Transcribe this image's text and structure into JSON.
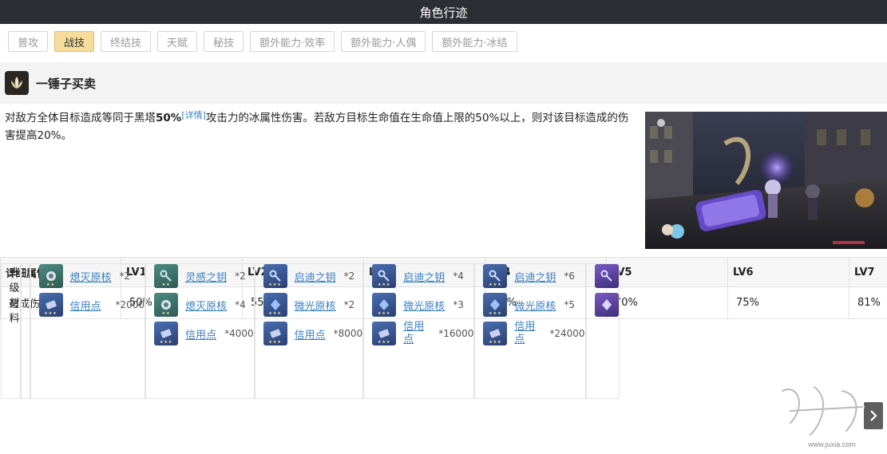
{
  "header": {
    "title": "角色行迹"
  },
  "tabs": [
    {
      "label": "普攻",
      "active": false
    },
    {
      "label": "战技",
      "active": true
    },
    {
      "label": "终结技",
      "active": false
    },
    {
      "label": "天赋",
      "active": false
    },
    {
      "label": "秘技",
      "active": false
    },
    {
      "label": "额外能力·效率",
      "active": false
    },
    {
      "label": "额外能力·人偶",
      "active": false
    },
    {
      "label": "额外能力·冰结",
      "active": false
    }
  ],
  "skill": {
    "icon": "lotus-bud-icon",
    "name": "一锤子买卖",
    "desc_part1": "对敌方全体目标造成等同于黑塔",
    "desc_bold": "50%",
    "desc_detail": "[详情]",
    "desc_part2": "攻击力的冰属性伤害。若敌方目标生命值在生命值上限的50%以上，则对该目标造成的伤害提高20%。"
  },
  "table": {
    "header_label": "详细属性",
    "levels": [
      "LV1",
      "LV2",
      "LV3",
      "LV4",
      "LV5",
      "LV6",
      "LV7"
    ],
    "damage_label": "造成伤害",
    "damage_values": [
      "50%",
      "55%",
      "60%",
      "65%",
      "70%",
      "75%",
      "81%"
    ],
    "materials_label": "升级材料",
    "materials": [
      [],
      [
        {
          "name": "熄灭原核",
          "count": "*2",
          "icon": "green"
        },
        {
          "name": "信用点",
          "count": "*2000",
          "icon": "blue"
        }
      ],
      [
        {
          "name": "灵感之钥",
          "count": "*2",
          "icon": "green"
        },
        {
          "name": "熄灭原核",
          "count": "*4",
          "icon": "green"
        },
        {
          "name": "信用点",
          "count": "*4000",
          "icon": "blue"
        }
      ],
      [
        {
          "name": "启迪之钥",
          "count": "*2",
          "icon": "blue"
        },
        {
          "name": "微光原核",
          "count": "*2",
          "icon": "blue"
        },
        {
          "name": "信用点",
          "count": "*8000",
          "icon": "blue"
        }
      ],
      [
        {
          "name": "启迪之钥",
          "count": "*4",
          "icon": "blue"
        },
        {
          "name": "微光原核",
          "count": "*3",
          "icon": "blue"
        },
        {
          "name": "信用点",
          "count": "*16000",
          "icon": "blue"
        }
      ],
      [
        {
          "name": "启迪之钥",
          "count": "*6",
          "icon": "blue"
        },
        {
          "name": "微光原核",
          "count": "*5",
          "icon": "blue"
        },
        {
          "name": "信用点",
          "count": "*24000",
          "icon": "blue"
        }
      ],
      [
        {
          "name": "",
          "count": "",
          "icon": "purple"
        },
        {
          "name": "",
          "count": "",
          "icon": "purple"
        }
      ]
    ]
  },
  "watermark": {
    "text": "聚侠网",
    "url": "www.juxia.com"
  }
}
